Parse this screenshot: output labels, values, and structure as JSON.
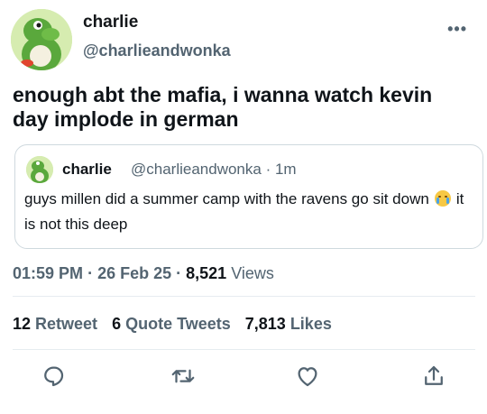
{
  "author": {
    "name": "charlie",
    "handle": "@charlieandwonka"
  },
  "tweet": {
    "text": "enough abt the mafia, i wanna watch kevin day implode in german"
  },
  "quoted_tweet": {
    "name": "charlie",
    "handle": "@charlieandwonka",
    "time": "1m",
    "text_before": "guys millen did a summer camp with the ravens go sit down",
    "text_after": "it is not this deep",
    "emoji": "crying-face"
  },
  "meta": {
    "time": "01:59 PM",
    "date": "26 Feb 25",
    "views_count": "8,521",
    "views_label": "Views"
  },
  "stats": {
    "retweets_count": "12",
    "retweets_label": "Retweet",
    "quotes_count": "6",
    "quotes_label": "Quote Tweets",
    "likes_count": "7,813",
    "likes_label": "Likes"
  },
  "icons": {
    "reply": "reply-icon",
    "retweet": "retweet-icon",
    "like": "heart-icon",
    "share": "share-icon",
    "more": "more-icon"
  },
  "colors": {
    "text": "#0f1419",
    "secondary": "#536471",
    "border": "#cfd9de"
  }
}
